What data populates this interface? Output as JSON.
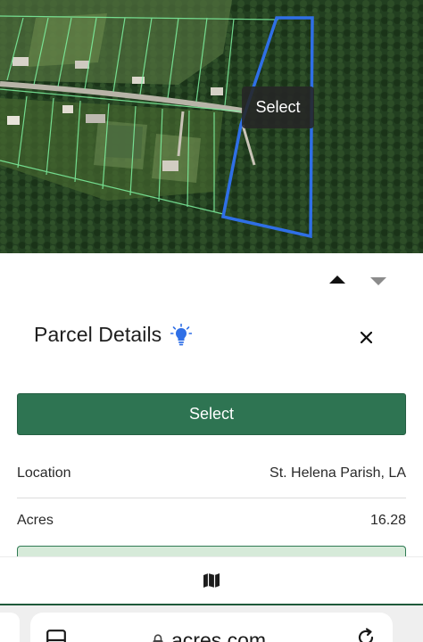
{
  "map": {
    "tooltip_label": "Select",
    "selected_parcel_color": "#2f6fe6",
    "parcel_line_color": "#7ef2a0"
  },
  "sheet": {
    "title": "Parcel Details",
    "select_label": "Select",
    "fields": {
      "location": {
        "label": "Location",
        "value": "St. Helena Parish, LA"
      },
      "acres": {
        "label": "Acres",
        "value": "16.28"
      }
    }
  },
  "icons": {
    "expand_up": "triangle-up-icon",
    "collapse_down": "triangle-down-icon",
    "tip": "lightbulb-icon",
    "close": "close-icon",
    "map": "map-icon",
    "tabs": "tabs-icon",
    "lock": "lock-icon",
    "reload": "reload-icon"
  },
  "colors": {
    "primary_button": "#2e7452",
    "bulb": "#2f6fe6"
  },
  "browser": {
    "url": "acres.com"
  }
}
